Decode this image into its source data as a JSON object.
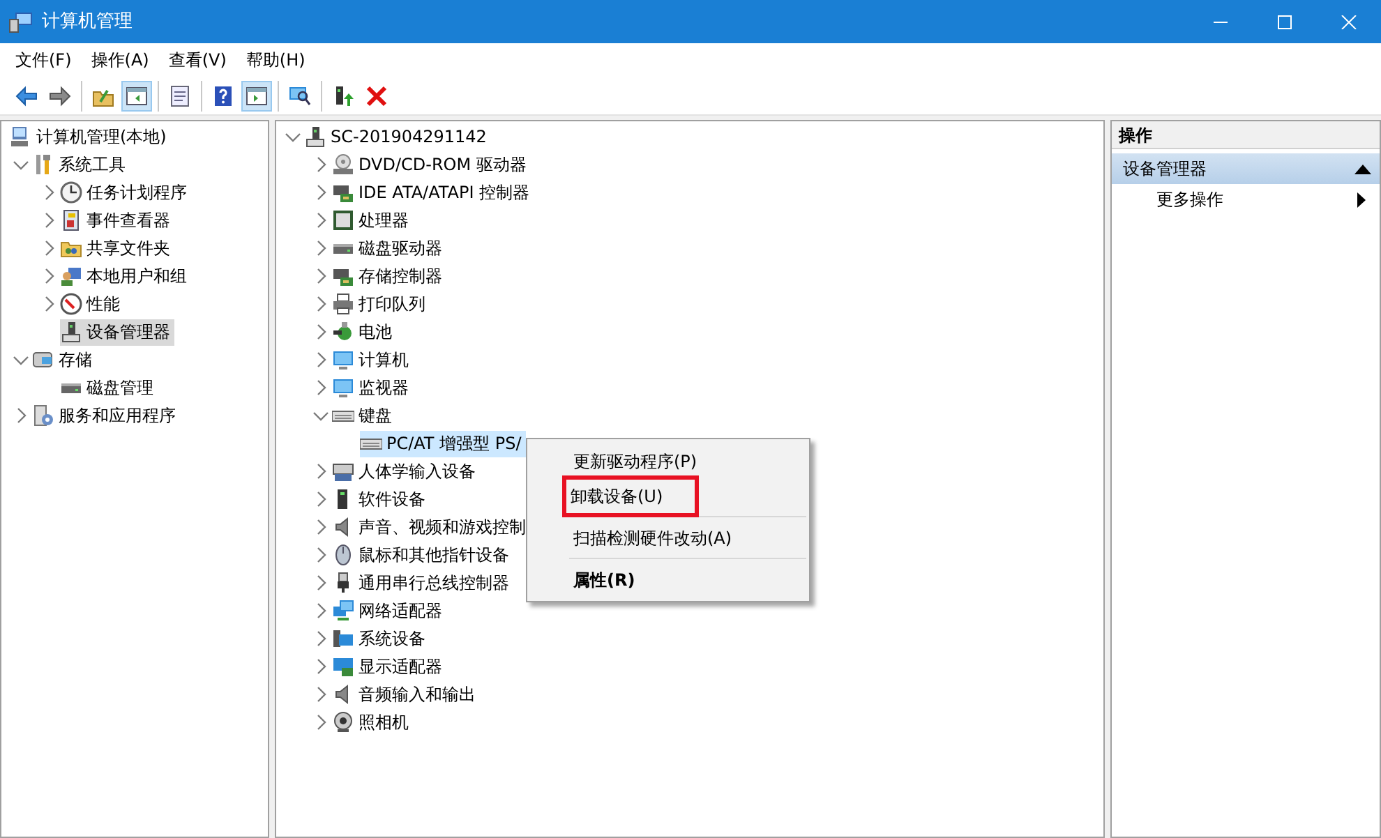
{
  "window": {
    "title": "计算机管理"
  },
  "menu": [
    "文件(F)",
    "操作(A)",
    "查看(V)",
    "帮助(H)"
  ],
  "toolbar": {
    "groups": [
      [
        {
          "pressed": false
        },
        {
          "pressed": false
        }
      ],
      [
        {
          "pressed": false
        },
        {
          "pressed": true
        }
      ],
      [
        {
          "pressed": false
        }
      ],
      [
        {
          "pressed": false
        },
        {
          "pressed": true
        }
      ],
      [
        {
          "pressed": false
        }
      ],
      [
        {
          "pressed": false
        },
        {
          "pressed": false
        }
      ]
    ]
  },
  "navigation_tree": [
    {
      "label": "计算机管理(本地)",
      "kind": "root",
      "selected": false,
      "children": [
        {
          "label": "系统工具",
          "kind": "branch",
          "expanded": true,
          "selected": false,
          "children": [
            {
              "label": "任务计划程序",
              "kind": "branch",
              "expanded": false,
              "selected": false
            },
            {
              "label": "事件查看器",
              "kind": "branch",
              "expanded": false,
              "selected": false
            },
            {
              "label": "共享文件夹",
              "kind": "branch",
              "expanded": false,
              "selected": false
            },
            {
              "label": "本地用户和组",
              "kind": "branch",
              "expanded": false,
              "selected": false
            },
            {
              "label": "性能",
              "kind": "branch",
              "expanded": false,
              "selected": false
            },
            {
              "label": "设备管理器",
              "kind": "leaf",
              "selected": true
            }
          ]
        },
        {
          "label": "存储",
          "kind": "branch",
          "expanded": true,
          "selected": false,
          "children": [
            {
              "label": "磁盘管理",
              "kind": "leaf",
              "selected": false
            }
          ]
        },
        {
          "label": "服务和应用程序",
          "kind": "branch",
          "expanded": false,
          "selected": false
        }
      ]
    }
  ],
  "device_tree": [
    {
      "label": "SC-201904291142",
      "kind": "branch",
      "expanded": true,
      "selected": false,
      "children": [
        {
          "label": "DVD/CD-ROM 驱动器",
          "kind": "branch",
          "expanded": false,
          "selected": false
        },
        {
          "label": "IDE ATA/ATAPI 控制器",
          "kind": "branch",
          "expanded": false,
          "selected": false
        },
        {
          "label": "处理器",
          "kind": "branch",
          "expanded": false,
          "selected": false
        },
        {
          "label": "磁盘驱动器",
          "kind": "branch",
          "expanded": false,
          "selected": false
        },
        {
          "label": "存储控制器",
          "kind": "branch",
          "expanded": false,
          "selected": false
        },
        {
          "label": "打印队列",
          "kind": "branch",
          "expanded": false,
          "selected": false
        },
        {
          "label": "电池",
          "kind": "branch",
          "expanded": false,
          "selected": false
        },
        {
          "label": "计算机",
          "kind": "branch",
          "expanded": false,
          "selected": false
        },
        {
          "label": "监视器",
          "kind": "branch",
          "expanded": false,
          "selected": false
        },
        {
          "label": "键盘",
          "kind": "branch",
          "expanded": true,
          "selected": false,
          "children": [
            {
              "label": "PC/AT 增强型 PS/",
              "kind": "leaf",
              "selected": true
            }
          ]
        },
        {
          "label": "人体学输入设备",
          "kind": "branch",
          "expanded": false,
          "selected": false
        },
        {
          "label": "软件设备",
          "kind": "branch",
          "expanded": false,
          "selected": false
        },
        {
          "label": "声音、视频和游戏控制",
          "kind": "branch",
          "expanded": false,
          "selected": false
        },
        {
          "label": "鼠标和其他指针设备",
          "kind": "branch",
          "expanded": false,
          "selected": false
        },
        {
          "label": "通用串行总线控制器",
          "kind": "branch",
          "expanded": false,
          "selected": false
        },
        {
          "label": "网络适配器",
          "kind": "branch",
          "expanded": false,
          "selected": false
        },
        {
          "label": "系统设备",
          "kind": "branch",
          "expanded": false,
          "selected": false
        },
        {
          "label": "显示适配器",
          "kind": "branch",
          "expanded": false,
          "selected": false
        },
        {
          "label": "音频输入和输出",
          "kind": "branch",
          "expanded": false,
          "selected": false
        },
        {
          "label": "照相机",
          "kind": "branch",
          "expanded": false,
          "selected": false
        }
      ]
    }
  ],
  "context_menu": [
    {
      "kind": "item",
      "label": "更新驱动程序(P)",
      "bold": false,
      "highlighted": false
    },
    {
      "kind": "item",
      "label": "卸载设备(U)",
      "bold": false,
      "highlighted": true
    },
    {
      "kind": "separator"
    },
    {
      "kind": "item",
      "label": "扫描检测硬件改动(A)",
      "bold": false,
      "highlighted": false
    },
    {
      "kind": "separator"
    },
    {
      "kind": "item",
      "label": "属性(R)",
      "bold": true,
      "highlighted": false
    }
  ],
  "actions_pane": {
    "header": "操作",
    "sections": [
      {
        "title": "设备管理器",
        "expanded": true,
        "items": [
          {
            "label": "更多操作"
          }
        ]
      }
    ]
  }
}
